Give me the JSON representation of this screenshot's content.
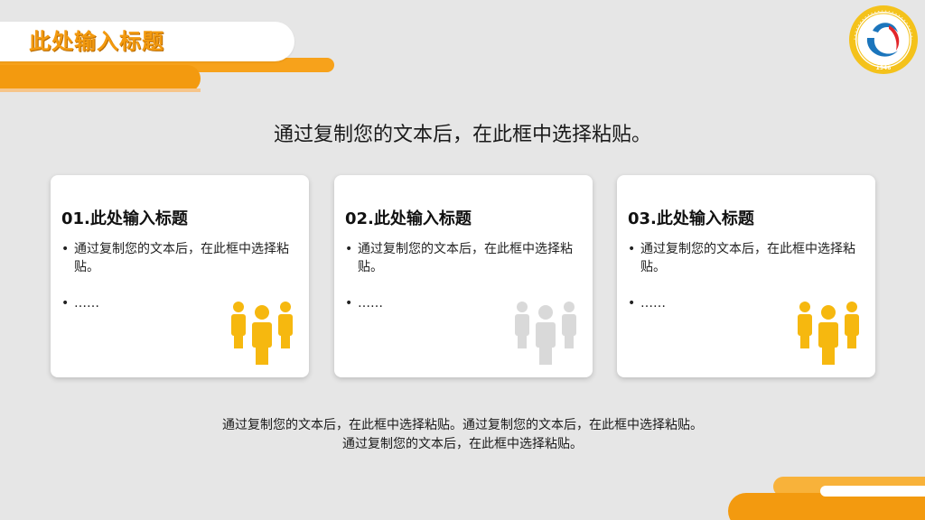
{
  "header": {
    "title": "此处输入标题"
  },
  "logo": {
    "name": "university-seal-logo",
    "ring_text": "NORTHEAST NORMAL UNIVERSITY · CHINA",
    "year": "1946"
  },
  "subtitle": "通过复制您的文本后，在此框中选择粘贴。",
  "cards": [
    {
      "title": "01.此处输入标题",
      "bullet": "通过复制您的文本后，在此框中选择粘贴。",
      "more": "……",
      "icon": "people-group-icon",
      "icon_color": "#f6b80f"
    },
    {
      "title": "02.此处输入标题",
      "bullet": "通过复制您的文本后，在此框中选择粘贴。",
      "more": "……",
      "icon": "people-group-icon",
      "icon_color": "#d9d9d9"
    },
    {
      "title": "03.此处输入标题",
      "bullet": "通过复制您的文本后，在此框中选择粘贴。",
      "more": "……",
      "icon": "people-group-icon",
      "icon_color": "#f6b80f"
    }
  ],
  "footer": {
    "line1": "通过复制您的文本后，在此框中选择粘贴。通过复制您的文本后，在此框中选择粘贴。",
    "line2": "通过复制您的文本后，在此框中选择粘贴。"
  },
  "colors": {
    "accent": "#f39a0f",
    "background": "#e6e6e6"
  }
}
